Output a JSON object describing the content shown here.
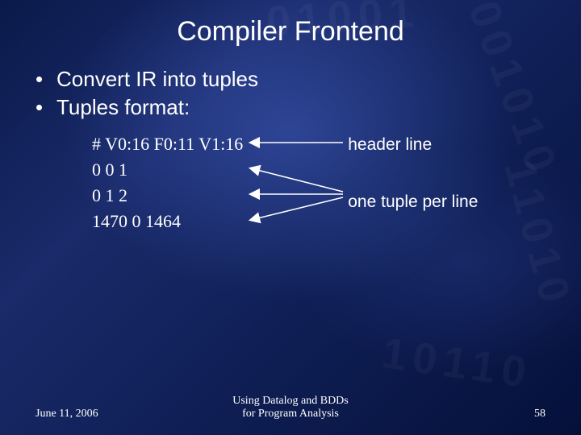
{
  "title": "Compiler Frontend",
  "bullets": {
    "b1": "Convert IR into tuples",
    "b2": "Tuples format:"
  },
  "code": {
    "l1": "# V0:16 F0:11 V1:16",
    "l2": "0 0 1",
    "l3": "0 1 2",
    "l4": "1470 0 1464"
  },
  "labels": {
    "header": "header line",
    "tuple": "one tuple per line"
  },
  "footer": {
    "date": "June 11, 2006",
    "subject": "Using Datalog and BDDs\nfor Program Analysis",
    "page": "58"
  }
}
